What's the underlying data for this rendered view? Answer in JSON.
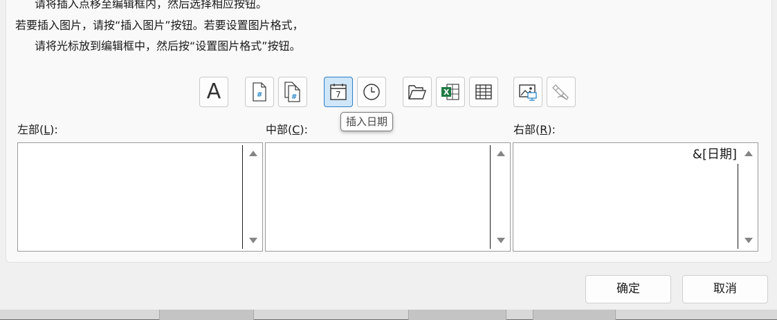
{
  "instructions": {
    "line1": "请将插入点移至编辑框内，然后选择相应按钮。",
    "line2": "若要插入图片，请按“插入图片”按钮。若要设置图片格式，",
    "line3": "请将光标放到编辑框中，然后按“设置图片格式”按钮。"
  },
  "toolbar": {
    "font_glyph": "A",
    "date_glyph": "7",
    "tooltip": "插入日期",
    "buttons": [
      {
        "name": "format-text",
        "icon": "letter-a-icon"
      },
      {
        "name": "insert-page-number",
        "icon": "page-number-icon"
      },
      {
        "name": "insert-number-of-pages",
        "icon": "number-of-pages-icon"
      },
      {
        "name": "insert-date",
        "icon": "calendar-icon",
        "active": true
      },
      {
        "name": "insert-time",
        "icon": "clock-icon"
      },
      {
        "name": "insert-file-path",
        "icon": "folder-open-icon"
      },
      {
        "name": "insert-file-name",
        "icon": "excel-file-icon"
      },
      {
        "name": "insert-sheet-name",
        "icon": "sheet-grid-icon"
      },
      {
        "name": "insert-picture",
        "icon": "picture-icon"
      },
      {
        "name": "format-picture",
        "icon": "format-picture-icon"
      }
    ]
  },
  "sections": {
    "left": {
      "prefix": "左部(",
      "key": "L",
      "suffix": "):",
      "value": ""
    },
    "center": {
      "prefix": "中部(",
      "key": "C",
      "suffix": "):",
      "value": ""
    },
    "right": {
      "prefix": "右部(",
      "key": "R",
      "suffix": "):",
      "value": "&[日期]"
    }
  },
  "dialog_buttons": {
    "ok": "确定",
    "cancel": "取消"
  },
  "colors": {
    "active_bg": "#cfe6f8",
    "active_border": "#2a7fc9",
    "excel_green": "#1d7a43",
    "accent_blue": "#2a86c8"
  }
}
